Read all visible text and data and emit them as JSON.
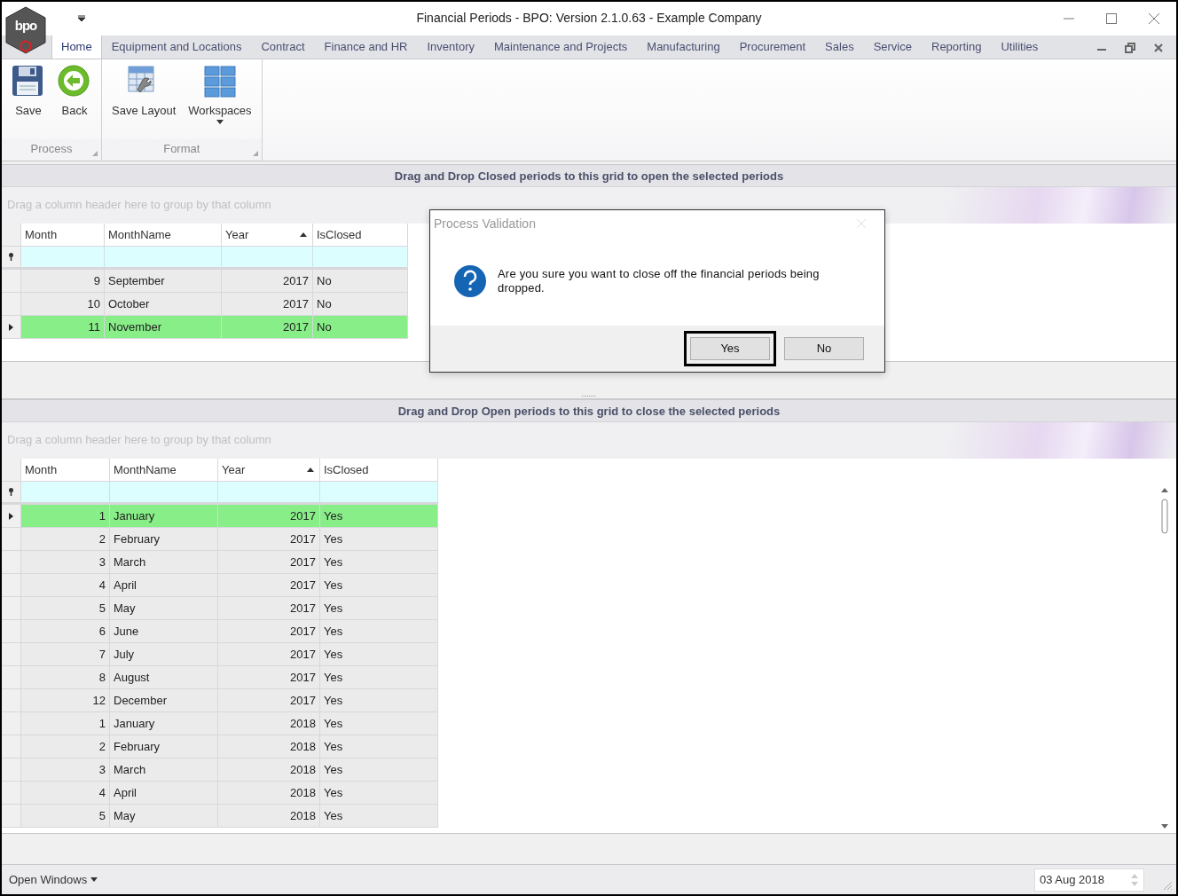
{
  "window": {
    "title": "Financial Periods - BPO: Version 2.1.0.63 - Example Company",
    "logo": "bpo"
  },
  "ribbon": {
    "tabs": [
      {
        "label": "Home",
        "selected": true
      },
      {
        "label": "Equipment and Locations",
        "selected": false
      },
      {
        "label": "Contract",
        "selected": false
      },
      {
        "label": "Finance and HR",
        "selected": false
      },
      {
        "label": "Inventory",
        "selected": false
      },
      {
        "label": "Maintenance and Projects",
        "selected": false
      },
      {
        "label": "Manufacturing",
        "selected": false
      },
      {
        "label": "Procurement",
        "selected": false
      },
      {
        "label": "Sales",
        "selected": false
      },
      {
        "label": "Service",
        "selected": false
      },
      {
        "label": "Reporting",
        "selected": false
      },
      {
        "label": "Utilities",
        "selected": false
      }
    ],
    "groups": [
      {
        "label": "Process",
        "buttons": [
          {
            "label": "Save",
            "kind": "save"
          },
          {
            "label": "Back",
            "kind": "back"
          }
        ]
      },
      {
        "label": "Format",
        "buttons": [
          {
            "label": "Save Layout",
            "kind": "layout"
          },
          {
            "label": "Workspaces",
            "kind": "workspaces",
            "dropdown": true
          }
        ]
      }
    ]
  },
  "grids": [
    {
      "caption": "Drag and Drop Closed periods to this grid to open the selected periods",
      "group_hint": "Drag a column header here to group by that column",
      "columns": [
        {
          "label": "Month",
          "sorted": false
        },
        {
          "label": "MonthName",
          "sorted": false
        },
        {
          "label": "Year",
          "sorted": true
        },
        {
          "label": "IsClosed",
          "sorted": false
        }
      ],
      "rows": [
        {
          "cells": [
            "9",
            "September",
            "2017",
            "No"
          ],
          "selected": false
        },
        {
          "cells": [
            "10",
            "October",
            "2017",
            "No"
          ],
          "selected": false
        },
        {
          "cells": [
            "11",
            "November",
            "2017",
            "No"
          ],
          "selected": true
        }
      ]
    },
    {
      "caption": "Drag and Drop Open periods to this grid to close the selected periods",
      "group_hint": "Drag a column header here to group by that column",
      "columns": [
        {
          "label": "Month",
          "sorted": false
        },
        {
          "label": "MonthName",
          "sorted": false
        },
        {
          "label": "Year",
          "sorted": true
        },
        {
          "label": "IsClosed",
          "sorted": false
        }
      ],
      "rows": [
        {
          "cells": [
            "1",
            "January",
            "2017",
            "Yes"
          ],
          "selected": true
        },
        {
          "cells": [
            "2",
            "February",
            "2017",
            "Yes"
          ],
          "selected": false
        },
        {
          "cells": [
            "3",
            "March",
            "2017",
            "Yes"
          ],
          "selected": false
        },
        {
          "cells": [
            "4",
            "April",
            "2017",
            "Yes"
          ],
          "selected": false
        },
        {
          "cells": [
            "5",
            "May",
            "2017",
            "Yes"
          ],
          "selected": false
        },
        {
          "cells": [
            "6",
            "June",
            "2017",
            "Yes"
          ],
          "selected": false
        },
        {
          "cells": [
            "7",
            "July",
            "2017",
            "Yes"
          ],
          "selected": false
        },
        {
          "cells": [
            "8",
            "August",
            "2017",
            "Yes"
          ],
          "selected": false
        },
        {
          "cells": [
            "12",
            "December",
            "2017",
            "Yes"
          ],
          "selected": false
        },
        {
          "cells": [
            "1",
            "January",
            "2018",
            "Yes"
          ],
          "selected": false
        },
        {
          "cells": [
            "2",
            "February",
            "2018",
            "Yes"
          ],
          "selected": false
        },
        {
          "cells": [
            "3",
            "March",
            "2018",
            "Yes"
          ],
          "selected": false
        },
        {
          "cells": [
            "4",
            "April",
            "2018",
            "Yes"
          ],
          "selected": false
        },
        {
          "cells": [
            "5",
            "May",
            "2018",
            "Yes"
          ],
          "selected": false
        }
      ]
    }
  ],
  "dialog": {
    "title": "Process Validation",
    "message": "Are you sure you want to close off the financial periods being dropped.",
    "buttons": [
      {
        "label": "Yes",
        "focused": true
      },
      {
        "label": "No",
        "focused": false
      }
    ]
  },
  "status_bar": {
    "open_windows": "Open Windows",
    "date": "03 Aug 2018"
  }
}
